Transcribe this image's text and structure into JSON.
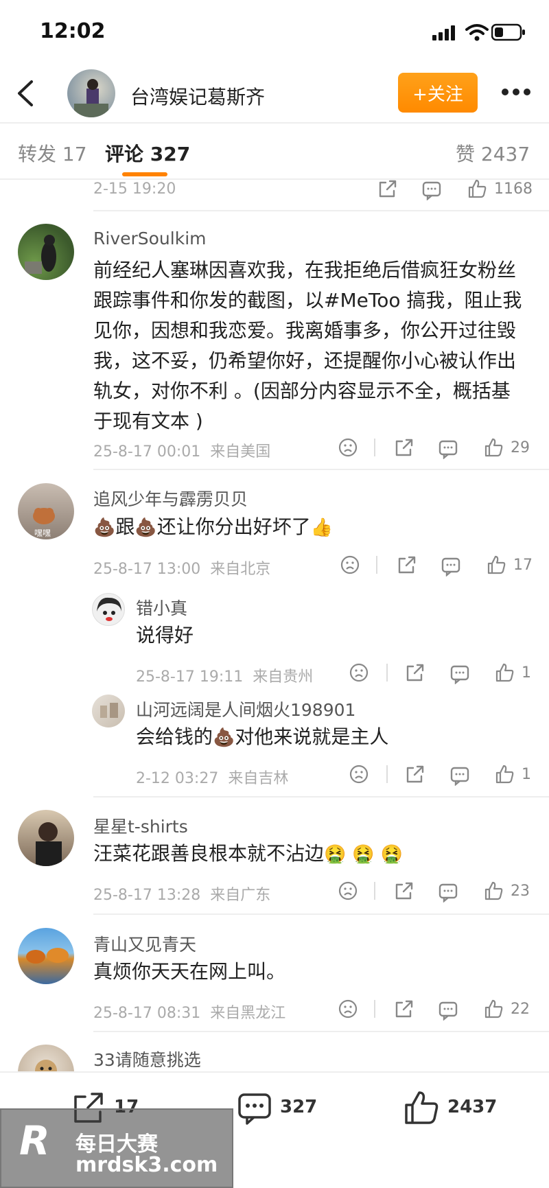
{
  "status_bar": {
    "time": "12:02"
  },
  "header": {
    "account_name": "台湾娱记葛斯齐",
    "follow_label": "+关注"
  },
  "tabs": [
    {
      "label": "转发",
      "count": "17"
    },
    {
      "label": "评论",
      "count": "327"
    },
    {
      "label": "赞",
      "count": "2437"
    }
  ],
  "top_partial": {
    "time": "2-15 19:20",
    "likes": "1168"
  },
  "comments": [
    {
      "user": "RiverSoulkim",
      "lines": [
        "前经纪人塞琳因喜欢我，在我拒绝后借疯狂女粉丝",
        "跟踪事件和你发的截图，以#MeToo 搞我，阻止我",
        "见你，因想和我恋爱。我离婚事多，你公开过往毁",
        "我，这不妥，仍希望你好，还提醒你小心被认作出",
        "轨女，对你不利 。(因部分内容显示不全，概括基",
        "于现有文本 )"
      ],
      "time": "25-8-17 00:01",
      "location": "来自美国",
      "likes": "29"
    },
    {
      "user": "追风少年与霹雳贝贝",
      "text_a": "跟",
      "text_b": "还让你分出好坏了",
      "avatar_label": "嘿嘿",
      "time": "25-8-17 13:00",
      "location": "来自北京",
      "likes": "17",
      "replies": [
        {
          "user": "错小真",
          "text": "说得好",
          "time": "25-8-17 19:11",
          "location": "来自贵州",
          "likes": "1"
        },
        {
          "user": "山河远阔是人间烟火198901",
          "text_a": "会给钱的",
          "text_b": "对他来说就是主人",
          "time": "2-12 03:27",
          "location": "来自吉林",
          "likes": "1"
        }
      ]
    },
    {
      "user": "星星t-shirts",
      "text": "汪菜花跟善良根本就不沾边",
      "time": "25-8-17 13:28",
      "location": "来自广东",
      "likes": "23"
    },
    {
      "user": "青山又见青天",
      "text": "真烦你天天在网上叫。",
      "time": "25-8-17 08:31",
      "location": "来自黑龙江",
      "likes": "22"
    },
    {
      "user": "33请随意挑选"
    }
  ],
  "bottom_bar": {
    "repost_count": "17",
    "comment_count": "327",
    "like_count": "2437"
  },
  "watermark": {
    "line1": "每日大赛",
    "line2": "mrdsk3.com",
    "logo_letter": "R"
  },
  "colors": {
    "accent": "#ff8200",
    "follow_bg": "#ff9a0e"
  },
  "icons": [
    "back-arrow-icon",
    "more-icon",
    "share-icon",
    "comment-icon",
    "like-icon",
    "sad-face-icon",
    "poop-emoji",
    "thumbs-up-emoji",
    "vomit-emoji"
  ]
}
